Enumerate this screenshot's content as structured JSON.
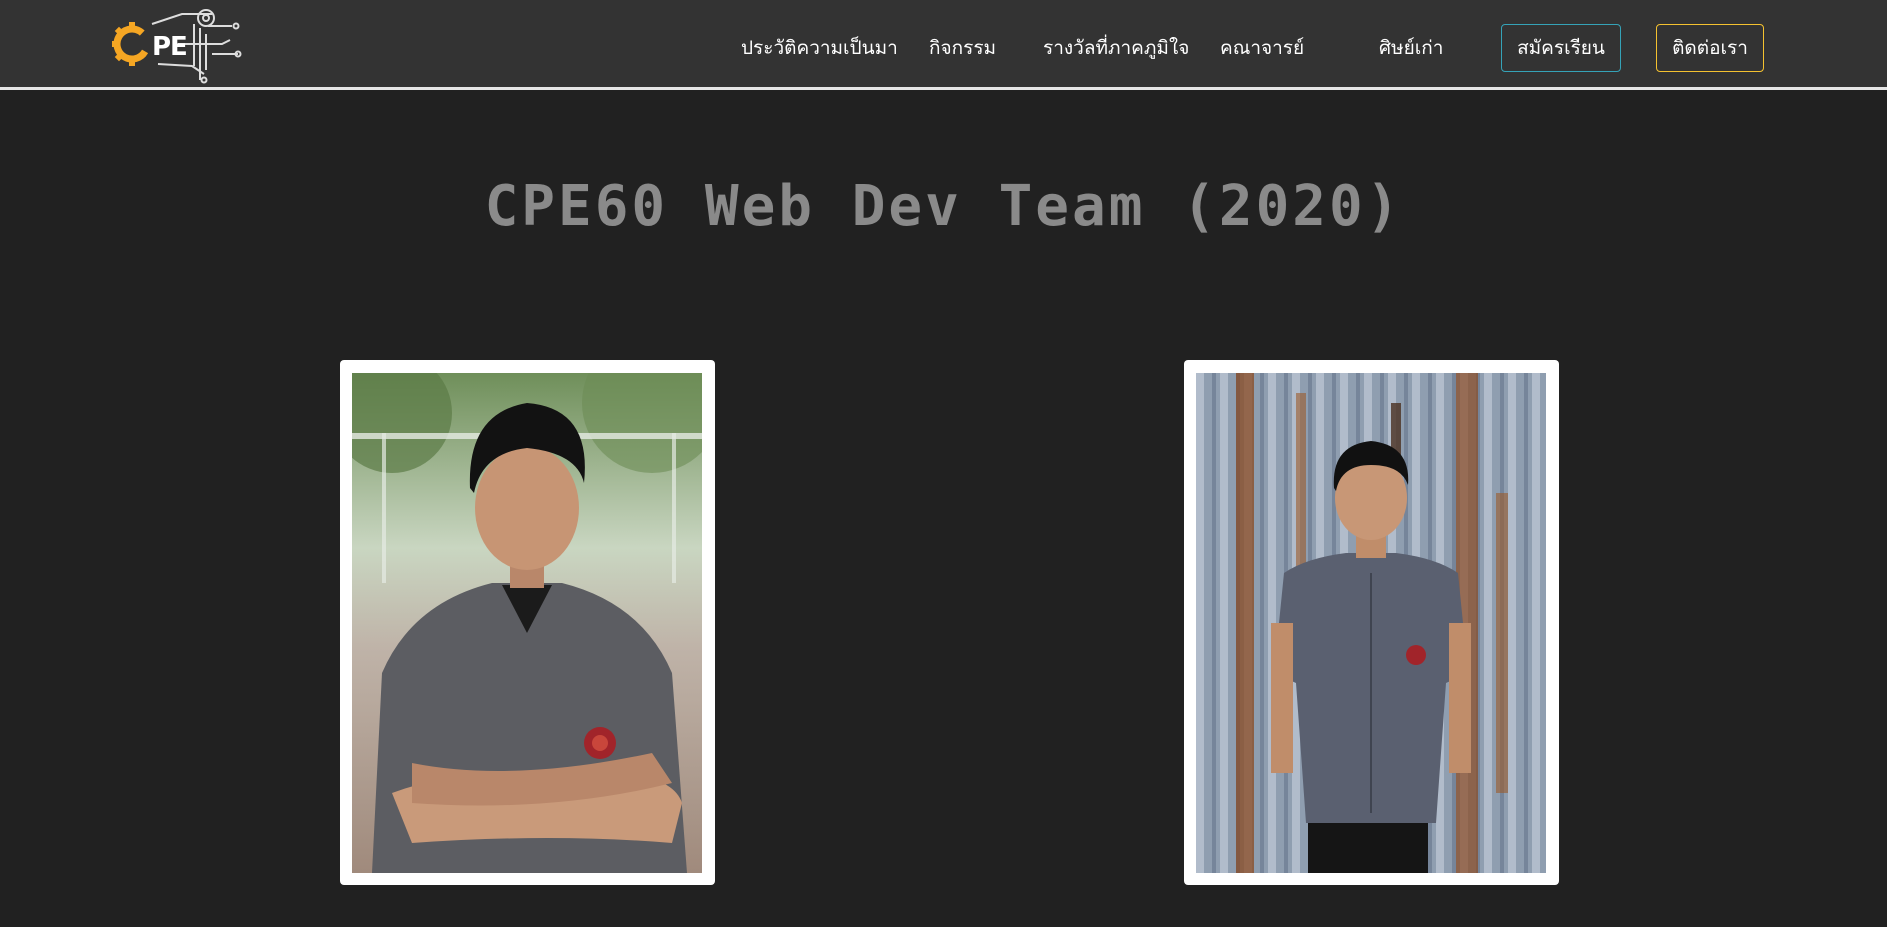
{
  "header": {
    "logo_text": "CPE",
    "nav": {
      "history": "ประวัติความเป็นมา",
      "activities": "กิจกรรม",
      "awards": "รางวัลที่ภาคภูมิใจ",
      "faculty": "คณาจารย์",
      "alumni": "ศิษย์เก่า"
    },
    "apply_label": "สมัครเรียน",
    "contact_label": "ติดต่อเรา"
  },
  "main": {
    "title": "CPE60 Web Dev Team (2020)",
    "members": [
      {
        "photo": "portrait-arms-crossed"
      },
      {
        "photo": "portrait-standing-rusty-wall"
      }
    ]
  },
  "colors": {
    "background": "#212121",
    "navbar": "#333333",
    "apply_border": "#35a3b8",
    "contact_border": "#f5c230",
    "logo_accent": "#f5a623"
  }
}
